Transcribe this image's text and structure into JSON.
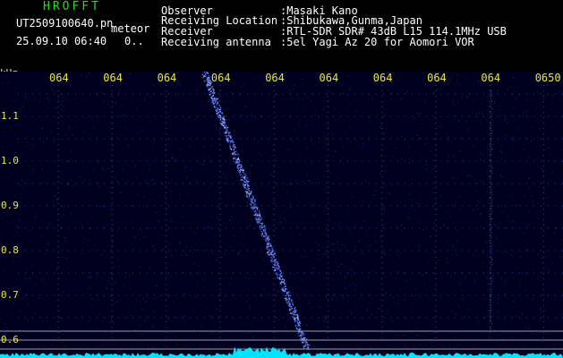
{
  "header": {
    "app_title": "HROFFT",
    "file_name": "UT2509100640.pn",
    "file_suffix": "meteor",
    "timestamp": "25.09.10 06:40",
    "extra": "0..",
    "info": [
      {
        "label": "Observer",
        "value": ":Masaki Kano"
      },
      {
        "label": "Receiving Location",
        "value": ":Shibukawa,Gunma,Japan"
      },
      {
        "label": "Receiver",
        "value": ":RTL-SDR SDR# 43dB L15 114.1MHz USB"
      },
      {
        "label": "Receiving antenna",
        "value": ":5el Yagi Az 20 for Aomori VOR"
      }
    ]
  },
  "colors": {
    "background": "#000000",
    "plot_background": "#00001e",
    "grid_dots": "#2a4aa8",
    "tick_labels": "#e6e640",
    "echo_trace": "#5a7bff",
    "noise_floor": "#00e5ff",
    "title": "#22dd22",
    "header_text": "#ffffff"
  },
  "chart_data": {
    "type": "heatmap",
    "ylabel": "kHz",
    "y_ticks": [
      "1.1",
      "1.0",
      "0.9",
      "0.8",
      "0.7",
      "0.6"
    ],
    "x_ticks": [
      "064",
      "064",
      "064",
      "064",
      "064",
      "064",
      "064",
      "064",
      "064",
      "0650"
    ],
    "echo_trace": {
      "start": {
        "minute_index": 2.7,
        "khz": 1.2
      },
      "end": {
        "minute_index": 4.6,
        "khz": 0.58
      }
    }
  }
}
